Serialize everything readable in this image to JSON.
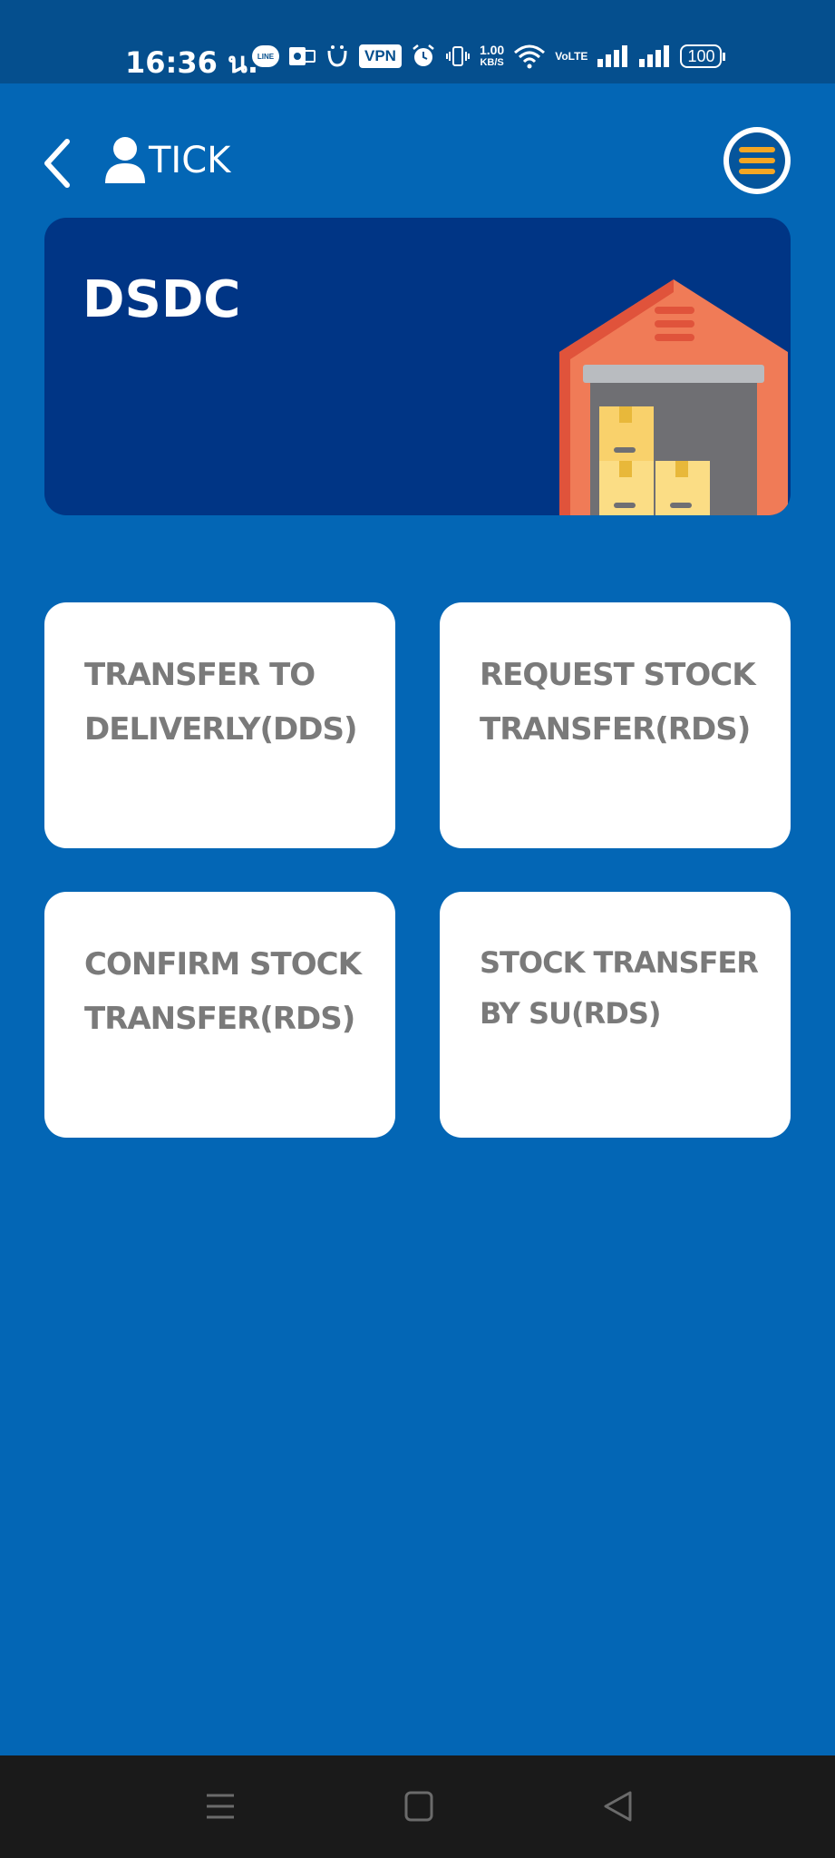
{
  "status_bar": {
    "time": "16:36 น.",
    "vpn": "VPN",
    "net_speed_value": "1.00",
    "net_speed_unit": "KB/S",
    "volte": "VoLTE",
    "battery": "100"
  },
  "header": {
    "user_name": "TICK"
  },
  "banner": {
    "title": "DSDC"
  },
  "tiles": [
    {
      "label": "TRANSFER TO DELIVERLY(DDS)"
    },
    {
      "label": "REQUEST STOCK TRANSFER(RDS)"
    },
    {
      "label": "CONFIRM STOCK TRANSFER(RDS)"
    },
    {
      "label": "STOCK TRANSFER BY SU(RDS)"
    }
  ],
  "colors": {
    "background": "#0366b5",
    "status_bar": "#054f8e",
    "banner": "#003585",
    "tile": "#ffffff",
    "tile_text": "#7a7a7a",
    "menu_accent": "#f5a623",
    "nav_bar": "#1a1a1a"
  },
  "icons": {
    "back": "back-arrow-icon",
    "user": "user-icon",
    "menu": "hamburger-menu-icon",
    "banner_art": "warehouse-illustration",
    "nav_menu": "recent-apps-icon",
    "nav_home": "home-icon",
    "nav_back": "back-triangle-icon"
  }
}
